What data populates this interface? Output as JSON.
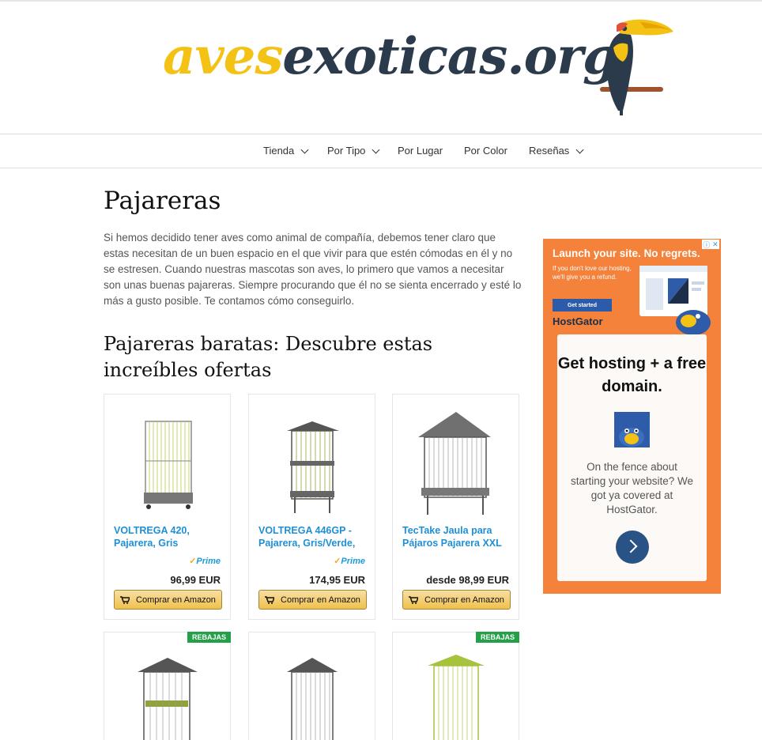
{
  "header": {
    "logo_part1": "aves",
    "logo_part2": "exoticas.org",
    "brand_colors": {
      "yellow": "#f4c215",
      "navy": "#2c3b4c"
    }
  },
  "nav": {
    "items": [
      {
        "label": "Tienda",
        "dropdown": true
      },
      {
        "label": "Por Tipo",
        "dropdown": true
      },
      {
        "label": "Por Lugar",
        "dropdown": false
      },
      {
        "label": "Por Color",
        "dropdown": false
      },
      {
        "label": "Reseñas",
        "dropdown": true
      }
    ]
  },
  "main": {
    "title": "Pajareras",
    "intro": "Si hemos decidido tener aves como animal de compañía, debemos tener claro que estas necesitan de un buen espacio en el que vivir para que estén cómodas en él y no se estresen. Cuando nuestras mascotas son aves, lo primero que vamos a necesitar son unas buenas pajareras. Siempre procurando que él no se sienta encerrado y esté lo más a gusto posible. Te contamos cómo conseguirlo.",
    "subtitle": "Pajareras baratas: Descubre estas increíbles ofertas"
  },
  "products": [
    {
      "title": "VOLTREGA 420, Pajarera, Gris",
      "prime": "Prime",
      "price": "96,99 EUR",
      "button": "Comprar en Amazon",
      "accent": "#b8c94a"
    },
    {
      "title": "VOLTREGA 446GP - Pajarera, Gris/Verde,",
      "prime": "Prime",
      "price": "174,95 EUR",
      "button": "Comprar en Amazon",
      "accent": "#8fa33a"
    },
    {
      "title": "TecTake Jaula para Pájaros Pajarera XXL",
      "price": "desde 98,99 EUR",
      "button": "Comprar en Amazon",
      "accent": "#6d6d6d"
    }
  ],
  "more_products": [
    {
      "badge": "REBAJAS",
      "accent": "#8fa33a"
    },
    {
      "badge": "",
      "accent": "#555555"
    },
    {
      "badge": "REBAJAS",
      "accent": "#a7c23b"
    }
  ],
  "ad": {
    "headline": "Launch your site. No regrets.",
    "small_text": "If you don't love our hosting, we'll give you a refund.",
    "cta": "Get started",
    "brand": "HostGator",
    "box_title": "Get hosting + a free domain.",
    "box_text": "On the fence about starting your website? We got ya covered at HostGator."
  }
}
